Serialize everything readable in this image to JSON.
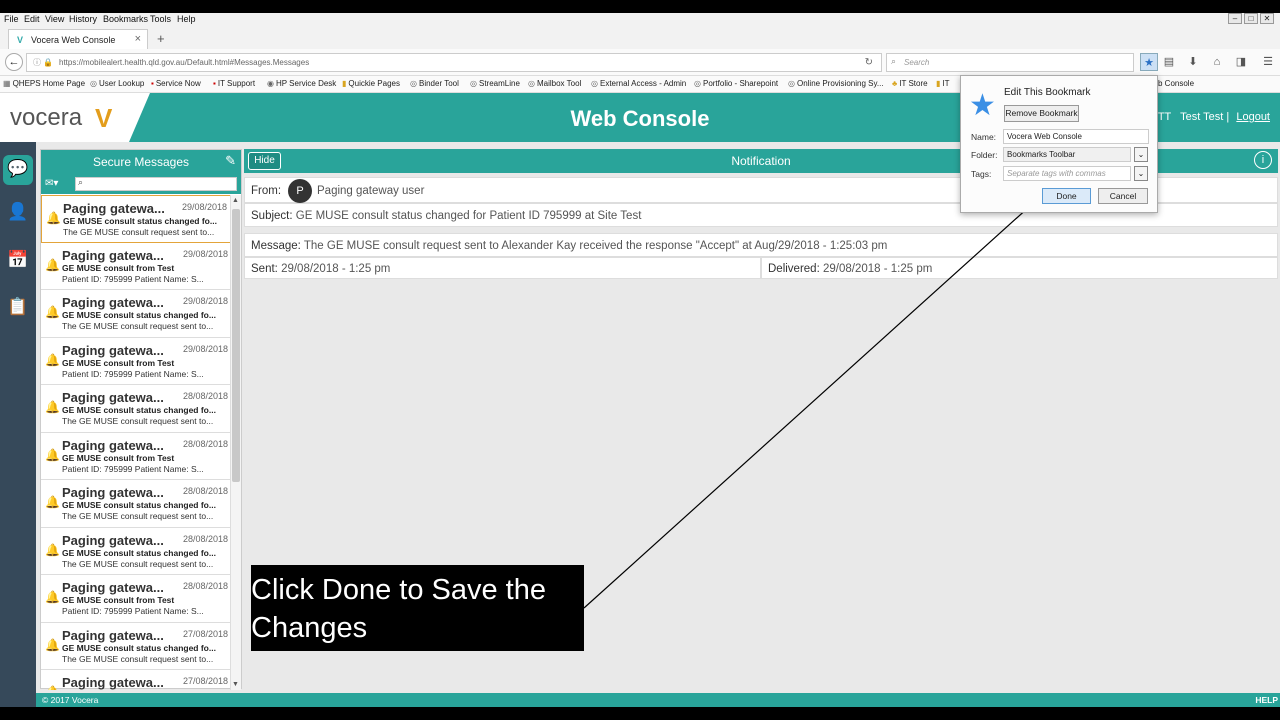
{
  "menubar": {
    "items": [
      "File",
      "Edit",
      "View",
      "History",
      "Bookmarks",
      "Tools",
      "Help"
    ]
  },
  "tab": {
    "title": "Vocera Web Console",
    "favicon": "V"
  },
  "nav": {
    "url": "https://mobilealert.health.qld.gov.au/Default.html#Messages.Messages",
    "search_placeholder": "Search"
  },
  "bookmarks": [
    "QHEPS Home Page",
    "User Lookup",
    "Service Now",
    "IT Support",
    "HP Service Desk",
    "Quickie Pages",
    "Binder Tool",
    "StreamLine",
    "Mailbox Tool",
    "External Access - Admin",
    "Portfolio - Sharepoint",
    "Online Provisioning Sy...",
    "IT Store",
    "IT",
    "b Console"
  ],
  "app": {
    "logo_text": "vocera",
    "logo_mark": "V",
    "title": "Web Console",
    "user_initials": "TT",
    "user_name": "Test Test",
    "logout": "Logout",
    "list": {
      "header": "Secure Messages",
      "messages": [
        {
          "title": "Paging gatewa...",
          "date": "29/08/2018",
          "subject": "GE MUSE consult status changed fo...",
          "preview": "The GE MUSE consult request sent to..."
        },
        {
          "title": "Paging gatewa...",
          "date": "29/08/2018",
          "subject": "GE MUSE consult from Test",
          "preview": "Patient ID: 795999 Patient Name: S..."
        },
        {
          "title": "Paging gatewa...",
          "date": "29/08/2018",
          "subject": "GE MUSE consult status changed fo...",
          "preview": "The GE MUSE consult request sent to..."
        },
        {
          "title": "Paging gatewa...",
          "date": "29/08/2018",
          "subject": "GE MUSE consult from Test",
          "preview": "Patient ID: 795999 Patient Name: S..."
        },
        {
          "title": "Paging gatewa...",
          "date": "28/08/2018",
          "subject": "GE MUSE consult status changed fo...",
          "preview": "The GE MUSE consult request sent to..."
        },
        {
          "title": "Paging gatewa...",
          "date": "28/08/2018",
          "subject": "GE MUSE consult from Test",
          "preview": "Patient ID: 795999 Patient Name: S..."
        },
        {
          "title": "Paging gatewa...",
          "date": "28/08/2018",
          "subject": "GE MUSE consult status changed fo...",
          "preview": "The GE MUSE consult request sent to..."
        },
        {
          "title": "Paging gatewa...",
          "date": "28/08/2018",
          "subject": "GE MUSE consult status changed fo...",
          "preview": "The GE MUSE consult request sent to..."
        },
        {
          "title": "Paging gatewa...",
          "date": "28/08/2018",
          "subject": "GE MUSE consult from Test",
          "preview": "Patient ID: 795999 Patient Name: S..."
        },
        {
          "title": "Paging gatewa...",
          "date": "27/08/2018",
          "subject": "GE MUSE consult status changed fo...",
          "preview": "The GE MUSE consult request sent to..."
        },
        {
          "title": "Paging gatewa...",
          "date": "27/08/2018",
          "subject": "",
          "preview": ""
        }
      ]
    },
    "detail": {
      "hide": "Hide",
      "header": "Notification",
      "from_label": "From:",
      "from_initial": "P",
      "from_value": "Paging gateway user",
      "subject_label": "Subject:",
      "subject_value": "GE MUSE consult status changed for Patient ID 795999 at Site Test",
      "message_label": "Message:",
      "message_value": "The GE MUSE consult request sent to Alexander Kay received the response \"Accept\" at Aug/29/2018 - 1:25:03 pm",
      "sent_label": "Sent:",
      "sent_value": "29/08/2018 - 1:25 pm",
      "delivered_label": "Delivered:",
      "delivered_value": "29/08/2018 - 1:25 pm"
    },
    "footer": {
      "copyright": "© 2017 Vocera",
      "help": "HELP"
    }
  },
  "bookmark_popup": {
    "title": "Edit This Bookmark",
    "remove": "Remove Bookmark",
    "name_label": "Name:",
    "name_value": "Vocera Web Console",
    "folder_label": "Folder:",
    "folder_value": "Bookmarks Toolbar",
    "tags_label": "Tags:",
    "tags_placeholder": "Separate tags with commas",
    "done": "Done",
    "cancel": "Cancel"
  },
  "caption": "Click Done to Save the Changes",
  "colors": {
    "teal": "#29a49a",
    "sidebar": "#36495a",
    "accent": "#e39d1c"
  }
}
